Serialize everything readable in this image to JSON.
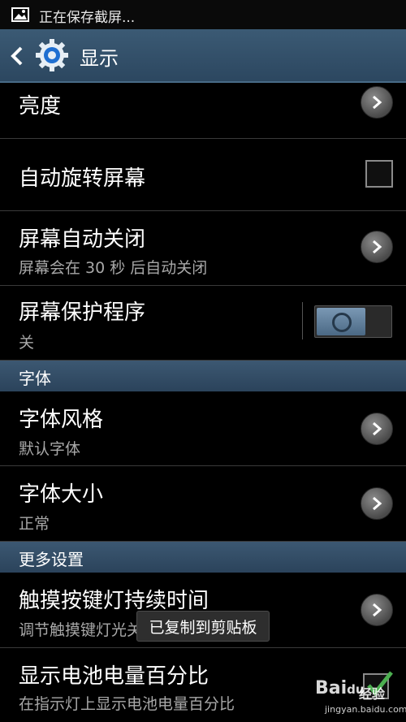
{
  "status_bar": {
    "notification_text": "正在保存截屏..."
  },
  "action_bar": {
    "title": "显示"
  },
  "settings": {
    "brightness": {
      "title": "亮度"
    },
    "auto_rotate": {
      "title": "自动旋转屏幕",
      "checked": false
    },
    "screen_timeout": {
      "title": "屏幕自动关闭",
      "subtitle": "屏幕会在 30 秒 后自动关闭"
    },
    "screensaver": {
      "title": "屏幕保护程序",
      "subtitle": "关",
      "toggle_on": false
    },
    "font_section": "字体",
    "font_style": {
      "title": "字体风格",
      "subtitle": "默认字体"
    },
    "font_size": {
      "title": "字体大小",
      "subtitle": "正常"
    },
    "more_section": "更多设置",
    "touch_key_light": {
      "title": "触摸按键灯持续时间",
      "subtitle": "调节触摸键灯光关闭前的延迟时间"
    },
    "battery_percent": {
      "title": "显示电池电量百分比",
      "subtitle": "在指示灯上显示电池电量百分比",
      "checked": true
    }
  },
  "toast": {
    "message": "已复制到剪贴板"
  },
  "watermark": {
    "brand": "Bai",
    "paw": "du",
    "cn": "经验",
    "url": "jingyan.baidu.com"
  },
  "colors": {
    "accent_header": "#3b5a74",
    "check_green": "#4caf50"
  }
}
